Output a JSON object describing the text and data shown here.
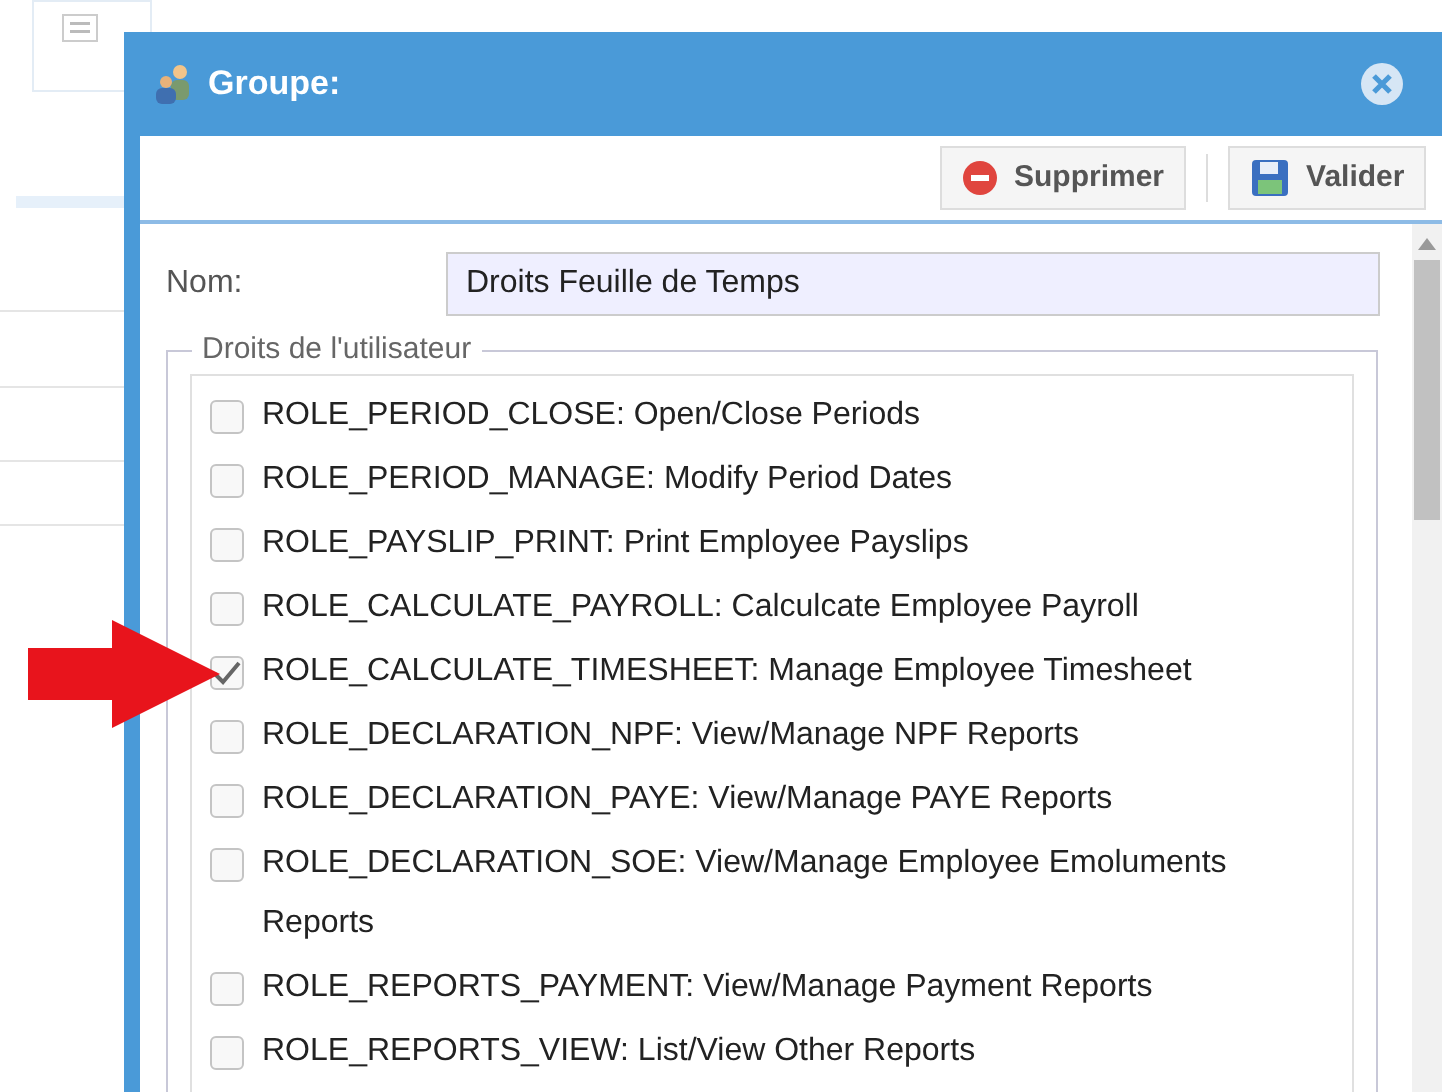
{
  "dialog": {
    "title": "Groupe:"
  },
  "toolbar": [
    {
      "kind": "delete",
      "label": "Supprimer"
    },
    {
      "kind": "save",
      "label": "Valider"
    }
  ],
  "name_field": {
    "label": "Nom:",
    "value": "Droits Feuille de Temps"
  },
  "rights": {
    "legend": "Droits de l'utilisateur",
    "items": [
      {
        "label": "ROLE_PERIOD_CLOSE: Open/Close Periods",
        "checked": false
      },
      {
        "label": "ROLE_PERIOD_MANAGE: Modify Period Dates",
        "checked": false
      },
      {
        "label": "ROLE_PAYSLIP_PRINT: Print Employee Payslips",
        "checked": false
      },
      {
        "label": "ROLE_CALCULATE_PAYROLL: Calculcate Employee Payroll",
        "checked": false
      },
      {
        "label": "ROLE_CALCULATE_TIMESHEET: Manage Employee Timesheet",
        "checked": true
      },
      {
        "label": "ROLE_DECLARATION_NPF: View/Manage NPF Reports",
        "checked": false
      },
      {
        "label": "ROLE_DECLARATION_PAYE: View/Manage PAYE Reports",
        "checked": false
      },
      {
        "label": "ROLE_DECLARATION_SOE: View/Manage Employee Emoluments Reports",
        "checked": false
      },
      {
        "label": "ROLE_REPORTS_PAYMENT: View/Manage Payment Reports",
        "checked": false
      },
      {
        "label": "ROLE_REPORTS_VIEW: List/View Other Reports",
        "checked": false
      }
    ]
  }
}
